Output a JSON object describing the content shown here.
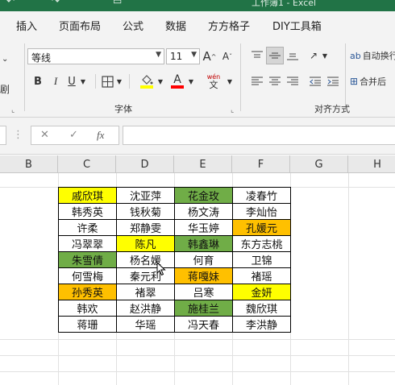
{
  "window": {
    "title": "工作簿1 - Excel"
  },
  "colors": {
    "accent": "#217346",
    "yellow": "#ffff00",
    "green": "#70ad47",
    "orange": "#ffc000",
    "font_color": "#ff0000",
    "highlight": "#ffff00"
  },
  "tabs": [
    "插入",
    "页面布局",
    "公式",
    "数据",
    "方方格子",
    "DIY工具箱"
  ],
  "ribbon": {
    "font_name": "等线",
    "font_size": "11",
    "grow_font": "A",
    "shrink_font": "A",
    "bold": "B",
    "italic": "I",
    "underline": "U",
    "phonetic_top": "wén",
    "phonetic_bottom": "文",
    "font_group": "字体",
    "align_group": "对齐方式",
    "wrap_text": "自动换行",
    "merge_center": "合并后",
    "left_edge": "剧"
  },
  "formula_bar": {
    "fx": "fx",
    "cancel": "✕",
    "enter": "✓",
    "value": ""
  },
  "columns": [
    "B",
    "C",
    "D",
    "E",
    "F",
    "G",
    "H"
  ],
  "grid": [
    [
      {
        "text": "戚欣琪",
        "fill": "yellow"
      },
      {
        "text": "沈亚萍",
        "fill": ""
      },
      {
        "text": "花金玫",
        "fill": "green"
      },
      {
        "text": "凌春竹",
        "fill": ""
      }
    ],
    [
      {
        "text": "韩秀英",
        "fill": ""
      },
      {
        "text": "钱秋菊",
        "fill": ""
      },
      {
        "text": "杨文涛",
        "fill": ""
      },
      {
        "text": "李灿怡",
        "fill": ""
      }
    ],
    [
      {
        "text": "许柔",
        "fill": ""
      },
      {
        "text": "郑静雯",
        "fill": ""
      },
      {
        "text": "华玉婷",
        "fill": ""
      },
      {
        "text": "孔媛元",
        "fill": "orange"
      }
    ],
    [
      {
        "text": "冯翠翠",
        "fill": ""
      },
      {
        "text": "陈凡",
        "fill": "yellow"
      },
      {
        "text": "韩鑫琳",
        "fill": "green"
      },
      {
        "text": "东方志桃",
        "fill": ""
      }
    ],
    [
      {
        "text": "朱雪倩",
        "fill": "green"
      },
      {
        "text": "杨名媛",
        "fill": ""
      },
      {
        "text": "何育",
        "fill": ""
      },
      {
        "text": "卫锦",
        "fill": ""
      }
    ],
    [
      {
        "text": "何雪梅",
        "fill": ""
      },
      {
        "text": "秦元利",
        "fill": ""
      },
      {
        "text": "蒋嘎妹",
        "fill": "orange"
      },
      {
        "text": "褚瑶",
        "fill": ""
      }
    ],
    [
      {
        "text": "孙秀英",
        "fill": "orange"
      },
      {
        "text": "褚翠",
        "fill": ""
      },
      {
        "text": "吕寒",
        "fill": ""
      },
      {
        "text": "金妍",
        "fill": "yellow"
      }
    ],
    [
      {
        "text": "韩欢",
        "fill": ""
      },
      {
        "text": "赵洪静",
        "fill": ""
      },
      {
        "text": "施桂兰",
        "fill": "green"
      },
      {
        "text": "魏欣琪",
        "fill": ""
      }
    ],
    [
      {
        "text": "蒋珊",
        "fill": ""
      },
      {
        "text": "华瑶",
        "fill": ""
      },
      {
        "text": "冯天春",
        "fill": ""
      },
      {
        "text": "李洪静",
        "fill": ""
      }
    ]
  ]
}
